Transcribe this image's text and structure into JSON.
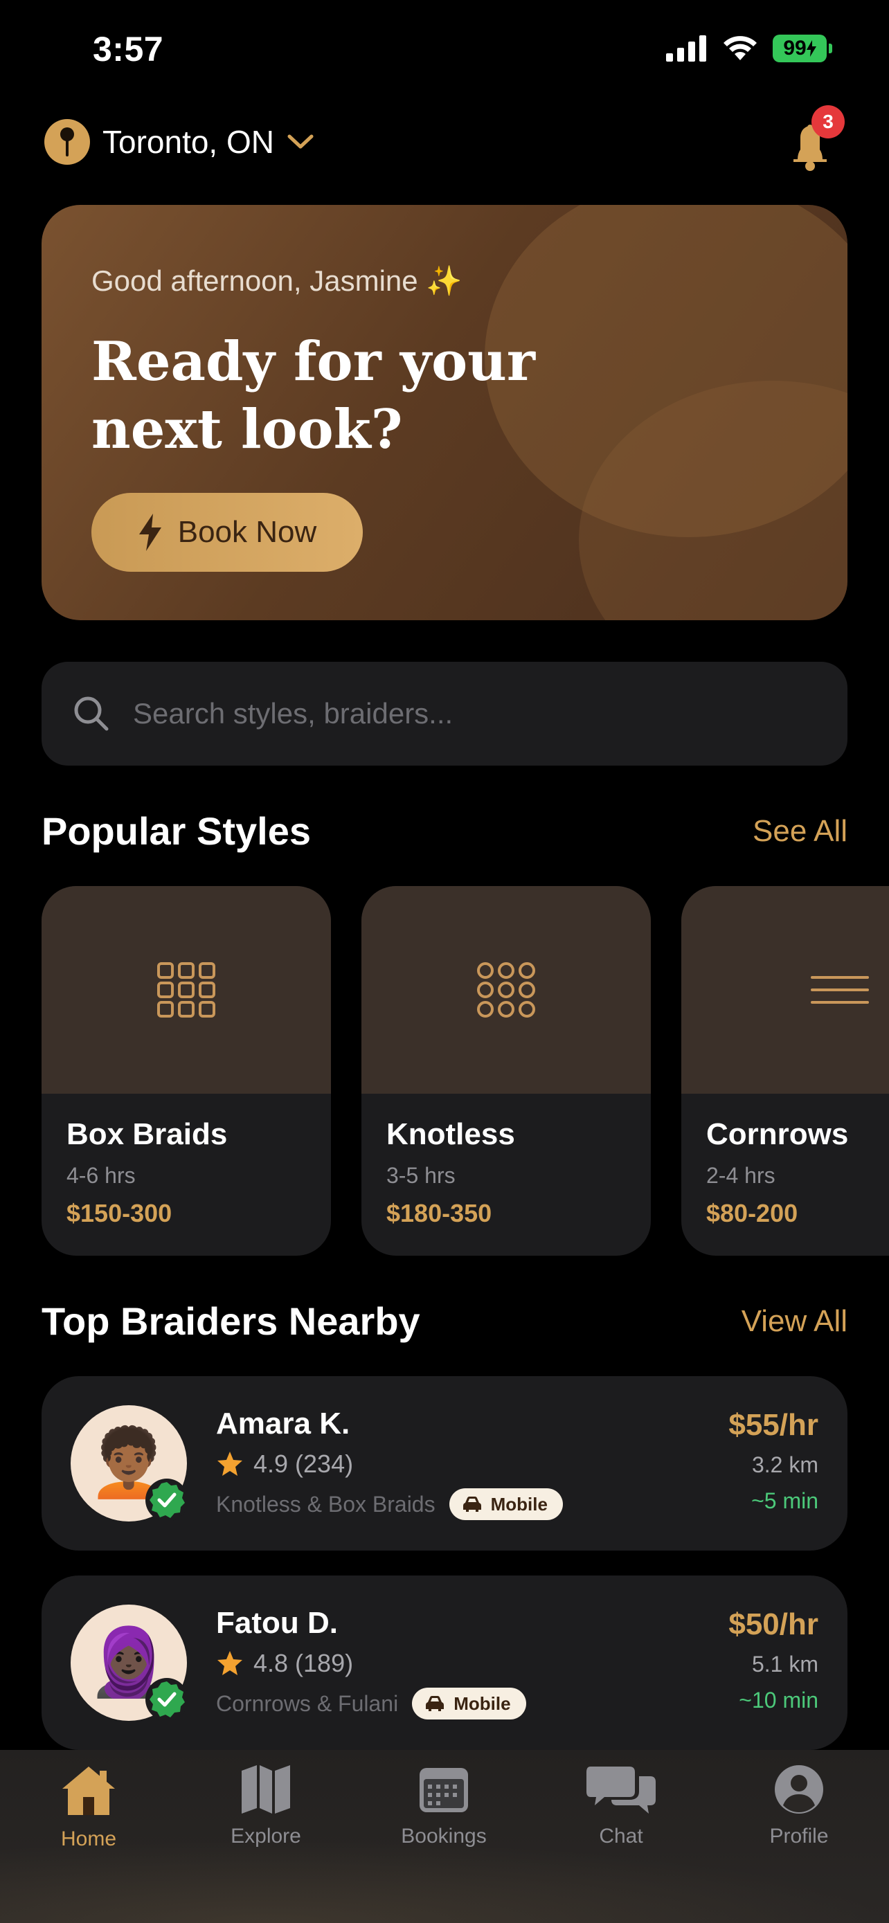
{
  "status_bar": {
    "time": "3:57",
    "battery": "99"
  },
  "header": {
    "location": "Toronto, ON",
    "notification_count": "3"
  },
  "hero": {
    "greeting": "Good afternoon, Jasmine ✨",
    "title": "Ready for your next look?",
    "cta_label": "Book Now"
  },
  "search": {
    "placeholder": "Search styles, braiders..."
  },
  "popular_styles": {
    "title": "Popular Styles",
    "link": "See All",
    "items": [
      {
        "name": "Box Braids",
        "duration": "4-6 hrs",
        "price": "$150-300",
        "icon": "grid-squares-icon"
      },
      {
        "name": "Knotless",
        "duration": "3-5 hrs",
        "price": "$180-350",
        "icon": "grid-circles-icon"
      },
      {
        "name": "Cornrows",
        "duration": "2-4 hrs",
        "price": "$80-200",
        "icon": "lines-icon"
      }
    ]
  },
  "braiders": {
    "title": "Top Braiders Nearby",
    "link": "View All",
    "items": [
      {
        "name": "Amara K.",
        "rating": "4.9",
        "reviews": "(234)",
        "specialty": "Knotless & Box Braids",
        "badge": "Mobile",
        "rate": "$55/hr",
        "distance": "3.2 km",
        "eta": "~5 min",
        "avatar": "🧑🏾‍🦱"
      },
      {
        "name": "Fatou D.",
        "rating": "4.8",
        "reviews": "(189)",
        "specialty": "Cornrows & Fulani",
        "badge": "Mobile",
        "rate": "$50/hr",
        "distance": "5.1 km",
        "eta": "~10 min",
        "avatar": "🧕🏿"
      }
    ]
  },
  "tabs": [
    {
      "label": "Home",
      "icon": "home-icon",
      "active": true
    },
    {
      "label": "Explore",
      "icon": "map-icon",
      "active": false
    },
    {
      "label": "Bookings",
      "icon": "calendar-icon",
      "active": false
    },
    {
      "label": "Chat",
      "icon": "chat-icon",
      "active": false
    },
    {
      "label": "Profile",
      "icon": "profile-icon",
      "active": false
    }
  ],
  "colors": {
    "accent": "#d4a257",
    "eta_green": "#4cc97a",
    "badge_red": "#e5383b",
    "verified_green": "#2fa84f"
  }
}
